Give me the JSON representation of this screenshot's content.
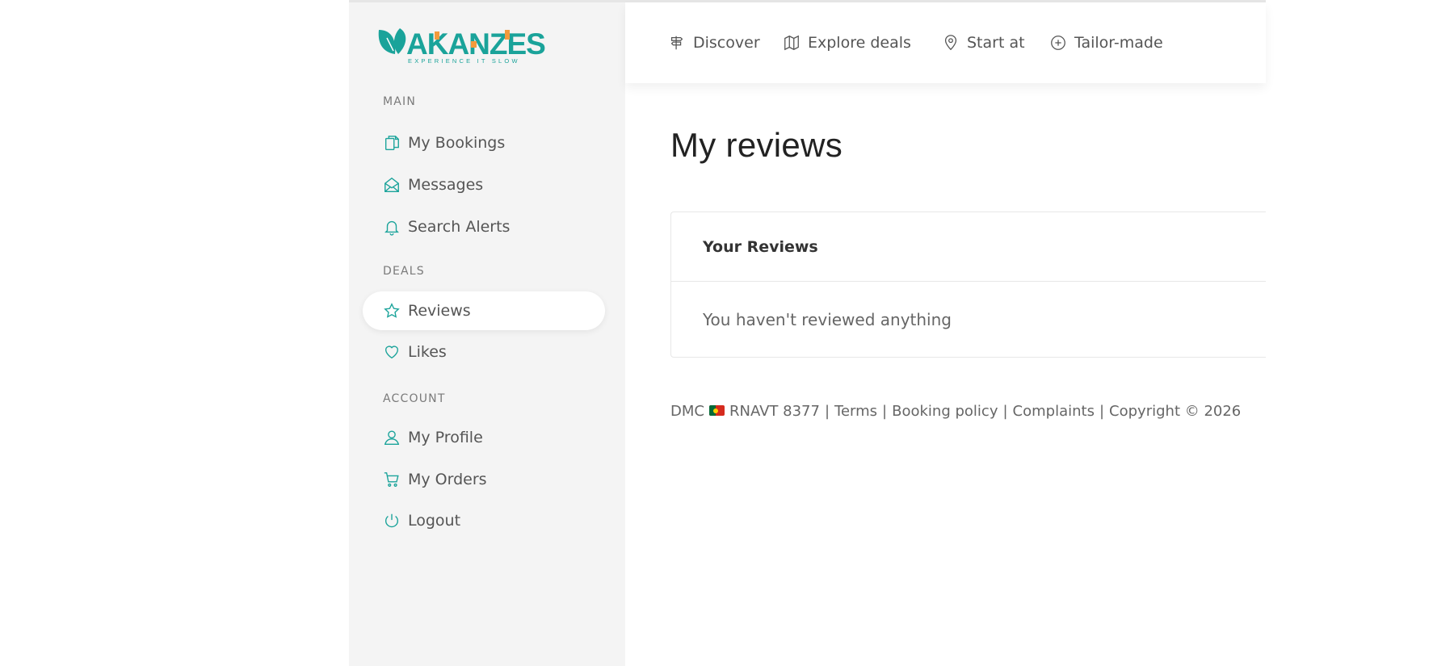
{
  "logo": {
    "text": "AKANZES",
    "tagline": "EXPERIENCE IT SLOW"
  },
  "colors": {
    "accent": "#1aa39a",
    "logo_orange": "#f39a3c",
    "sidebar_bg": "#f4f4f4"
  },
  "sidebar": {
    "sections": {
      "main": "MAIN",
      "deals": "DEALS",
      "account": "ACCOUNT"
    },
    "items": [
      {
        "label": "My Bookings",
        "icon": "documents-icon"
      },
      {
        "label": "Messages",
        "icon": "envelope-open-icon"
      },
      {
        "label": "Search Alerts",
        "icon": "bell-icon"
      },
      {
        "label": "Reviews",
        "icon": "star-icon",
        "active": true
      },
      {
        "label": "Likes",
        "icon": "heart-icon"
      },
      {
        "label": "My Profile",
        "icon": "user-icon"
      },
      {
        "label": "My Orders",
        "icon": "cart-icon"
      },
      {
        "label": "Logout",
        "icon": "power-icon"
      }
    ]
  },
  "topnav": [
    {
      "label": "Discover",
      "icon": "signpost-icon"
    },
    {
      "label": "Explore deals",
      "icon": "map-icon"
    },
    {
      "label": "Start at",
      "icon": "location-pin-icon"
    },
    {
      "label": "Tailor-made",
      "icon": "plus-circle-icon"
    }
  ],
  "main": {
    "title": "My reviews",
    "card": {
      "header": "Your Reviews",
      "empty_message": "You haven't reviewed anything"
    }
  },
  "footer": {
    "dmc": "DMC",
    "rnavt": "RNAVT 8377",
    "terms": "Terms",
    "booking_policy": "Booking policy",
    "complaints": "Complaints",
    "copyright": "Copyright © 2026",
    "separator": "|"
  }
}
